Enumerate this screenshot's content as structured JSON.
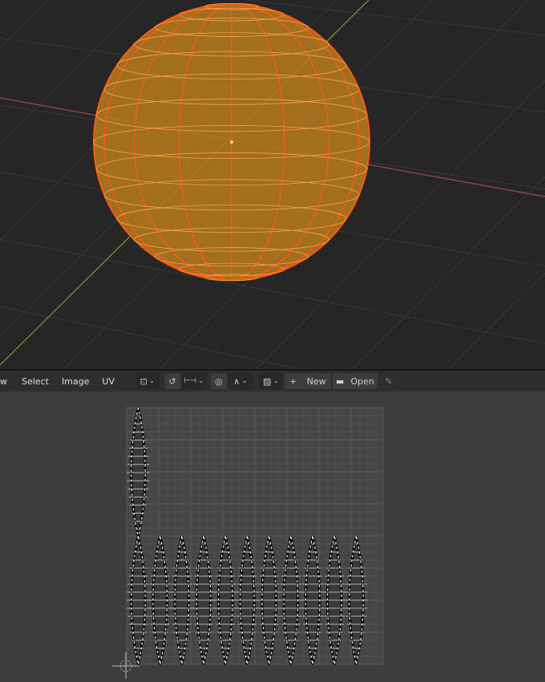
{
  "header_menu": {
    "view_partial": "w",
    "select": "Select",
    "image": "Image",
    "uv": "UV"
  },
  "toolbar": {
    "new_label": "New",
    "open_label": "Open",
    "plus_glyph": "+"
  },
  "colors": {
    "viewport_bg": "#262626",
    "sphere_fill": "#b07820",
    "sphere_wire": "#ff5a14",
    "x_axis": "#a0484e",
    "y_axis": "#7d9a2e",
    "uv_bg": "#3d3d3d",
    "uv_grid": "#555555"
  }
}
